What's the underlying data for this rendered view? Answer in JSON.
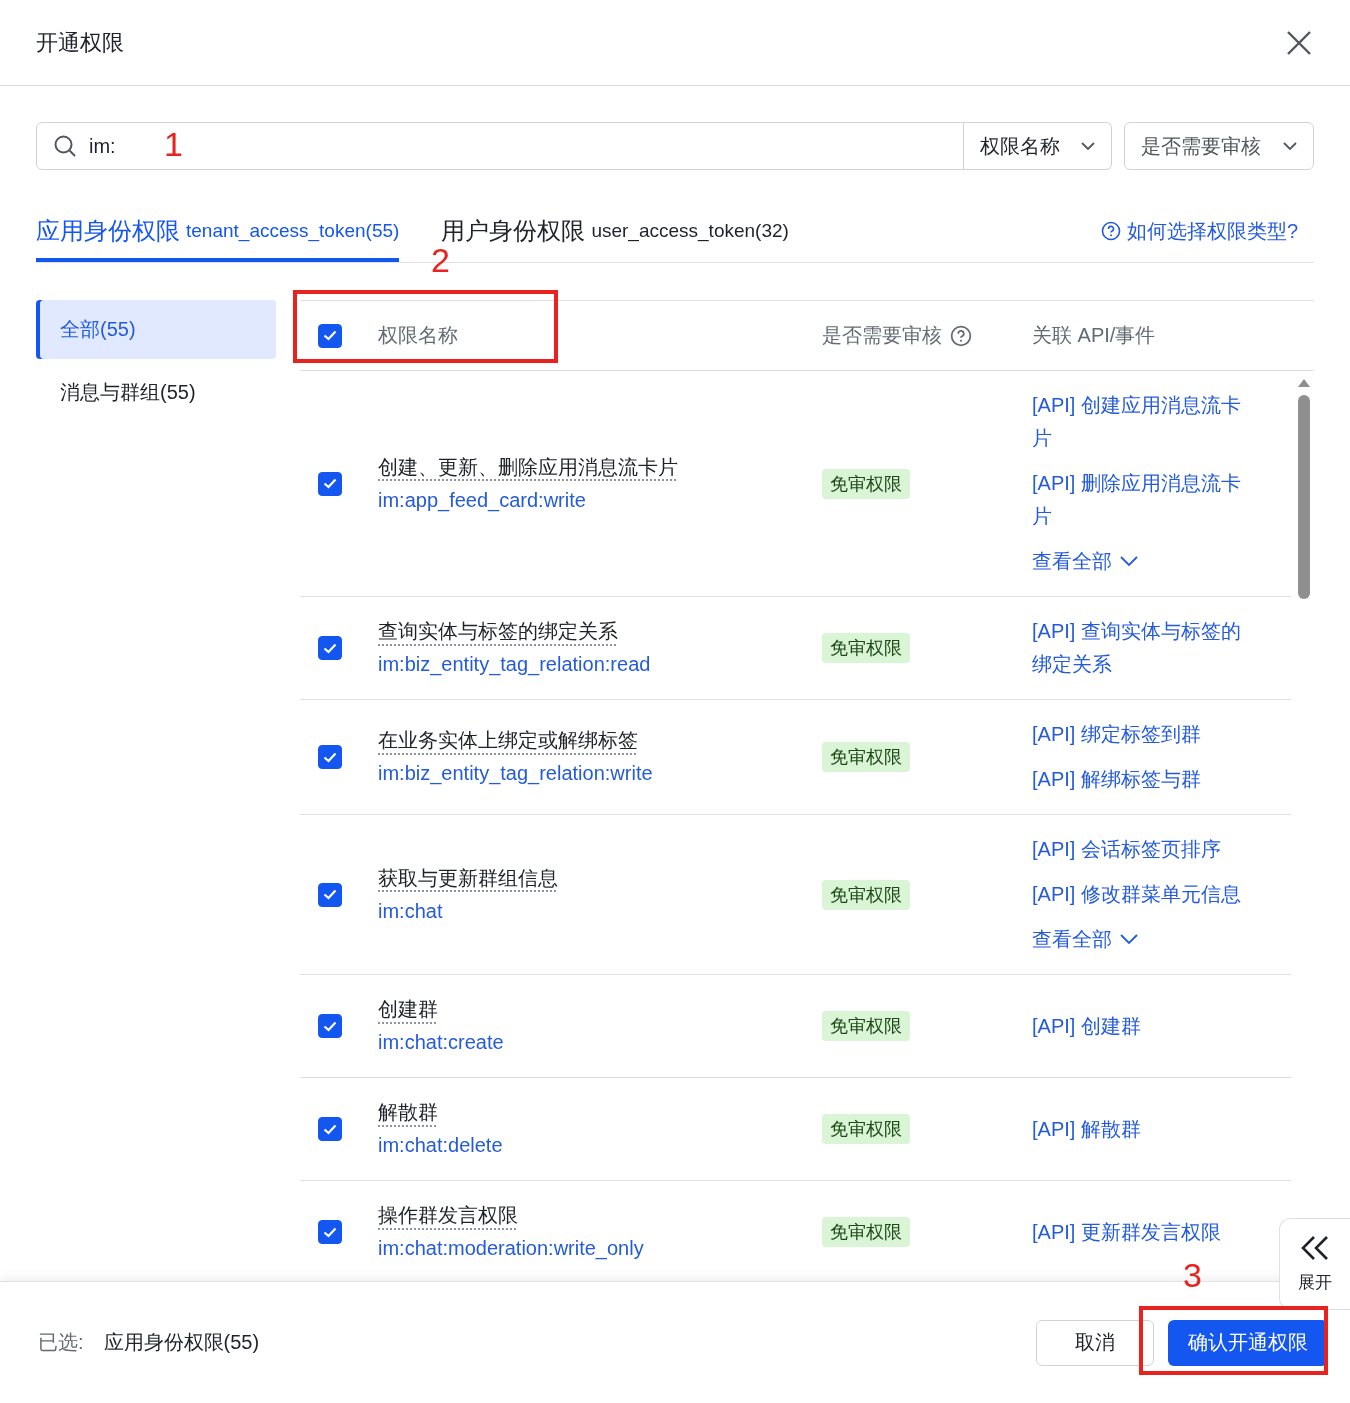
{
  "dialog": {
    "title": "开通权限"
  },
  "search": {
    "value": "im:",
    "filters": [
      "权限名称",
      "是否需要审核"
    ]
  },
  "tabs": [
    {
      "label": "应用身份权限",
      "token": "tenant_access_token(55)",
      "selected": true
    },
    {
      "label": "用户身份权限",
      "token": "user_access_token(32)",
      "selected": false
    }
  ],
  "help_link": "如何选择权限类型?",
  "sidebar": {
    "items": [
      {
        "label": "全部(55)",
        "selected": true
      },
      {
        "label": "消息与群组(55)",
        "selected": false
      }
    ]
  },
  "table": {
    "select_all_checked": true,
    "columns": [
      "权限名称",
      "是否需要审核",
      "关联 API/事件"
    ],
    "rows": [
      {
        "checked": true,
        "name": "创建、更新、删除应用消息流卡片",
        "scope": "im:app_feed_card:write",
        "review": "免审权限",
        "apis": [
          "[API] 创建应用消息流卡片",
          "[API] 删除应用消息流卡片"
        ],
        "view_all": "查看全部"
      },
      {
        "checked": true,
        "name": "查询实体与标签的绑定关系",
        "scope": "im:biz_entity_tag_relation:read",
        "review": "免审权限",
        "apis": [
          "[API] 查询实体与标签的绑定关系"
        ]
      },
      {
        "checked": true,
        "name": "在业务实体上绑定或解绑标签",
        "scope": "im:biz_entity_tag_relation:write",
        "review": "免审权限",
        "apis": [
          "[API] 绑定标签到群",
          "[API] 解绑标签与群"
        ]
      },
      {
        "checked": true,
        "name": "获取与更新群组信息",
        "scope": "im:chat",
        "review": "免审权限",
        "apis": [
          "[API] 会话标签页排序",
          "[API] 修改群菜单元信息"
        ],
        "view_all": "查看全部"
      },
      {
        "checked": true,
        "name": "创建群",
        "scope": "im:chat:create",
        "review": "免审权限",
        "apis": [
          "[API] 创建群"
        ]
      },
      {
        "checked": true,
        "name": "解散群",
        "scope": "im:chat:delete",
        "review": "免审权限",
        "apis": [
          "[API] 解散群"
        ]
      },
      {
        "checked": true,
        "name": "操作群发言权限",
        "scope": "im:chat:moderation:write_only",
        "review": "免审权限",
        "apis": [
          "[API] 更新群发言权限"
        ]
      }
    ]
  },
  "expand_tab": {
    "label": "展开"
  },
  "footer": {
    "selected_label": "已选:",
    "selected_value": "应用身份权限(55)",
    "buttons": [
      {
        "label": "取消",
        "kind": "secondary"
      },
      {
        "label": "确认开通权限",
        "kind": "primary"
      }
    ]
  },
  "annotations": [
    {
      "kind": "number",
      "label": "1"
    },
    {
      "kind": "number",
      "label": "2"
    },
    {
      "kind": "box"
    },
    {
      "kind": "number",
      "label": "3"
    },
    {
      "kind": "box"
    }
  ]
}
